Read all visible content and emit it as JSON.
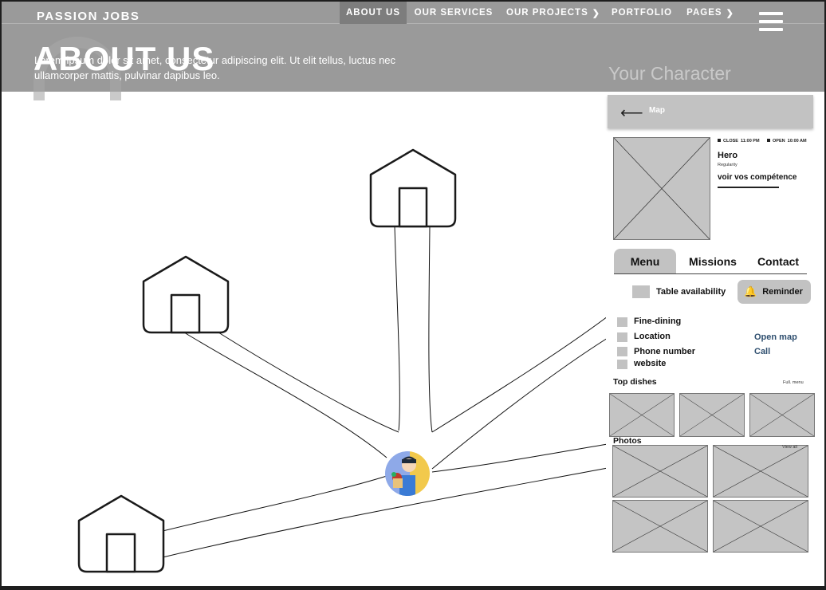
{
  "header": {
    "brand": "PASSION JOBS",
    "nav": [
      {
        "label": "ABOUT US",
        "active": true
      },
      {
        "label": "OUR SERVICES"
      },
      {
        "label": "OUR PROJECTS",
        "caret": true
      },
      {
        "label": "PORTFOLIO"
      },
      {
        "label": "PAGES",
        "caret": true
      }
    ],
    "menu_icon": "hamburger-icon",
    "title": "ABOUT US",
    "description": "Lorem ipsum dolor sit amet, consectetur adipiscing elit. Ut elit tellus, luctus nec ullamcorper mattis, pulvinar dapibus leo.",
    "panel_title": "Your Character"
  },
  "map": {
    "houses": 4,
    "avatar": "avatar-character"
  },
  "panel": {
    "map_label": "Map",
    "back_icon": "arrow-left-icon",
    "close_label": "CLOSE",
    "close_time": "11:00 PM",
    "open_label": "OPEN",
    "open_time": "10:00 AM",
    "hero_name": "Hero",
    "hero_sub": "Regularity",
    "skills_link": "voir vos compétence",
    "tabs": [
      "Menu",
      "Missions",
      "Contact"
    ],
    "availability": "Table availability",
    "reminder": "Reminder",
    "reminder_icon": "bell-icon",
    "info": [
      {
        "label": "Fine-dining",
        "link": ""
      },
      {
        "label": "Location",
        "link": "Open map"
      },
      {
        "label": "Phone number",
        "link": "Call"
      },
      {
        "label": "website",
        "link": ""
      }
    ],
    "top_dishes": "Top dishes",
    "full_menu": "Full. menu",
    "photos": "Photos",
    "view_all": "View all"
  }
}
